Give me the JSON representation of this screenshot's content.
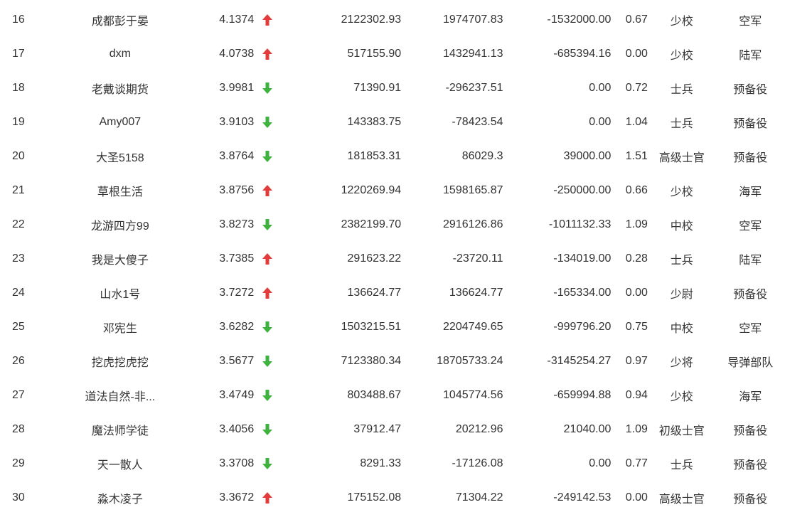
{
  "colors": {
    "up": "#e23b3b",
    "down": "#3fb13f",
    "text": "#333333"
  },
  "rows": [
    {
      "rank": "16",
      "name": "成都彭于晏",
      "score": "4.1374",
      "dir": "up",
      "v1": "2122302.93",
      "v2": "1974707.83",
      "v3": "-1532000.00",
      "v4": "0.67",
      "title": "少校",
      "branch": "空军"
    },
    {
      "rank": "17",
      "name": "dxm",
      "score": "4.0738",
      "dir": "up",
      "v1": "517155.90",
      "v2": "1432941.13",
      "v3": "-685394.16",
      "v4": "0.00",
      "title": "少校",
      "branch": "陆军"
    },
    {
      "rank": "18",
      "name": "老戴谈期货",
      "score": "3.9981",
      "dir": "down",
      "v1": "71390.91",
      "v2": "-296237.51",
      "v3": "0.00",
      "v4": "0.72",
      "title": "士兵",
      "branch": "预备役"
    },
    {
      "rank": "19",
      "name": "Amy007",
      "score": "3.9103",
      "dir": "down",
      "v1": "143383.75",
      "v2": "-78423.54",
      "v3": "0.00",
      "v4": "1.04",
      "title": "士兵",
      "branch": "预备役"
    },
    {
      "rank": "20",
      "name": "大圣5158",
      "score": "3.8764",
      "dir": "down",
      "v1": "181853.31",
      "v2": "86029.3",
      "v3": "39000.00",
      "v4": "1.51",
      "title": "高级士官",
      "branch": "预备役"
    },
    {
      "rank": "21",
      "name": "草根生活",
      "score": "3.8756",
      "dir": "up",
      "v1": "1220269.94",
      "v2": "1598165.87",
      "v3": "-250000.00",
      "v4": "0.66",
      "title": "少校",
      "branch": "海军"
    },
    {
      "rank": "22",
      "name": "龙游四方99",
      "score": "3.8273",
      "dir": "down",
      "v1": "2382199.70",
      "v2": "2916126.86",
      "v3": "-1011132.33",
      "v4": "1.09",
      "title": "中校",
      "branch": "空军"
    },
    {
      "rank": "23",
      "name": "我是大傻子",
      "score": "3.7385",
      "dir": "up",
      "v1": "291623.22",
      "v2": "-23720.11",
      "v3": "-134019.00",
      "v4": "0.28",
      "title": "士兵",
      "branch": "陆军"
    },
    {
      "rank": "24",
      "name": "山水1号",
      "score": "3.7272",
      "dir": "up",
      "v1": "136624.77",
      "v2": "136624.77",
      "v3": "-165334.00",
      "v4": "0.00",
      "title": "少尉",
      "branch": "预备役"
    },
    {
      "rank": "25",
      "name": "邓宪生",
      "score": "3.6282",
      "dir": "down",
      "v1": "1503215.51",
      "v2": "2204749.65",
      "v3": "-999796.20",
      "v4": "0.75",
      "title": "中校",
      "branch": "空军"
    },
    {
      "rank": "26",
      "name": "挖虎挖虎挖",
      "score": "3.5677",
      "dir": "down",
      "v1": "7123380.34",
      "v2": "18705733.24",
      "v3": "-3145254.27",
      "v4": "0.97",
      "title": "少将",
      "branch": "导弹部队"
    },
    {
      "rank": "27",
      "name": "道法自然-非...",
      "score": "3.4749",
      "dir": "down",
      "v1": "803488.67",
      "v2": "1045774.56",
      "v3": "-659994.88",
      "v4": "0.94",
      "title": "少校",
      "branch": "海军"
    },
    {
      "rank": "28",
      "name": "魔法师学徒",
      "score": "3.4056",
      "dir": "down",
      "v1": "37912.47",
      "v2": "20212.96",
      "v3": "21040.00",
      "v4": "1.09",
      "title": "初级士官",
      "branch": "预备役"
    },
    {
      "rank": "29",
      "name": "天一散人",
      "score": "3.3708",
      "dir": "down",
      "v1": "8291.33",
      "v2": "-17126.08",
      "v3": "0.00",
      "v4": "0.77",
      "title": "士兵",
      "branch": "预备役"
    },
    {
      "rank": "30",
      "name": "淼木凌子",
      "score": "3.3672",
      "dir": "up",
      "v1": "175152.08",
      "v2": "71304.22",
      "v3": "-249142.53",
      "v4": "0.00",
      "title": "高级士官",
      "branch": "预备役"
    }
  ]
}
